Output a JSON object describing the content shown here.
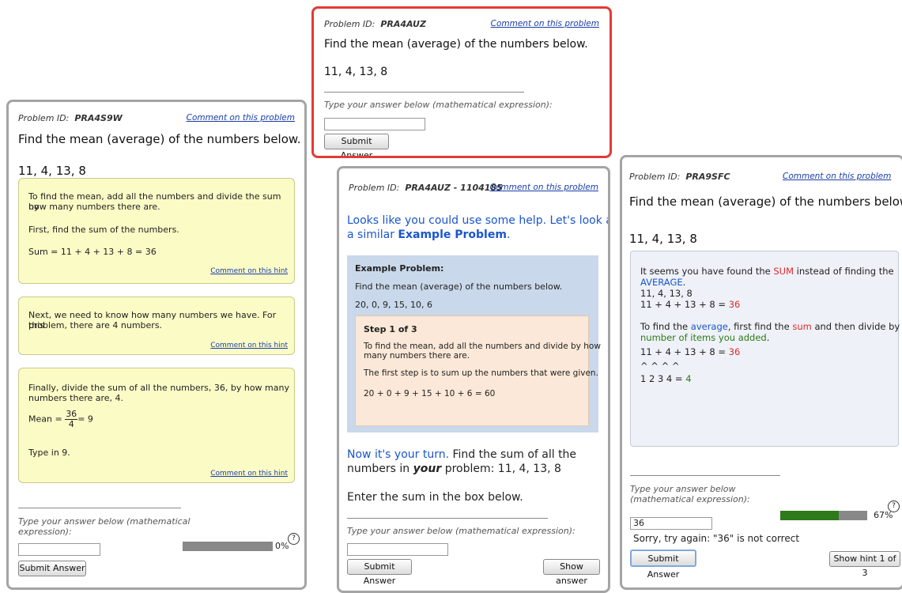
{
  "p1": {
    "problem_id_label": "Problem ID:",
    "problem_id": "PRA4S9W",
    "comment_link": "Comment on this problem",
    "question": "Find the mean (average) of the numbers below.",
    "numbers": "11,  4,  13,  8",
    "hint1": {
      "line1": "To find the mean, add all the numbers and divide the sum by",
      "line2": "how many numbers there are.",
      "line3": "First, find the sum of the numbers.",
      "line4": "Sum = 11 + 4 + 13 + 8 = 36",
      "link": "Comment on this hint"
    },
    "hint2": {
      "line1": "Next, we need to know how many numbers we have.  For this",
      "line2": "problem, there are 4 numbers.",
      "link": "Comment on this hint"
    },
    "hint3": {
      "line1": "Finally, divide the sum of all the numbers, 36, by how many",
      "line2": "numbers there are, 4.",
      "mean_label": "Mean =",
      "frac_num": "36",
      "frac_den": "4",
      "mean_result": "= 9",
      "line4": "Type in 9.",
      "link": "Comment on this hint"
    },
    "prompt_line1": "Type your answer below (mathematical",
    "prompt_line2": "expression):",
    "answer_value": "",
    "submit": "Submit Answer",
    "progress_pct": 0,
    "progress_label": "0%",
    "help_glyph": "?"
  },
  "p2": {
    "problem_id_label": "Problem ID:",
    "problem_id": "PRA4AUZ",
    "comment_link": "Comment on this problem",
    "question": "Find the mean (average) of the numbers below.",
    "numbers": "11,  4,  13,  8",
    "prompt": "Type your answer below (mathematical expression):",
    "answer_value": "",
    "submit": "Submit Answer"
  },
  "p3": {
    "problem_id_label": "Problem ID:",
    "problem_id": "PRA4AUZ - 1104185",
    "comment_link": "Comment on this problem",
    "help_line1": "Looks like you could use some help. Let's look at",
    "help_line2a": "a similar",
    "help_line2b": "Example Problem",
    "help_line2c": ".",
    "example_title": "Example Problem:",
    "example_question": "Find the mean (average) of the numbers below.",
    "example_numbers": "20,  0,  9,  15,  10,  6",
    "step_title": "Step 1 of 3",
    "step_line1": "To find the mean, add all the numbers and divide by how",
    "step_line2": "many numbers there are.",
    "step_line3": "The first step is to sum up the numbers that were given.",
    "step_line4": "20 + 0 + 9 + 15 + 10 + 6  = 60",
    "turn_a": "Now it's your turn.",
    "turn_b": "Find the sum of all the",
    "turn_line2a": "numbers in",
    "turn_line2b": "your",
    "turn_line2c": "problem: 11, 4, 13, 8",
    "enter_sum": "Enter the sum in the box below.",
    "prompt": "Type your answer below (mathematical expression):",
    "answer_value": "",
    "submit": "Submit Answer",
    "show_answer": "Show answer"
  },
  "p4": {
    "problem_id_label": "Problem ID:",
    "problem_id": "PRA9SFC",
    "comment_link": "Comment on this problem",
    "question": "Find the mean (average) of the numbers below.",
    "numbers": "11,  4,  13,  8",
    "fb": {
      "l1a": "It seems you have found the",
      "l1b": "SUM",
      "l1c": "instead of finding the",
      "l2": "AVERAGE",
      "l2b": ".",
      "l3": "11,  4,  13,  8",
      "l4a": "11 + 4 + 13 + 8 =",
      "l4b": "36",
      "l5a": "To find the",
      "l5b": "average",
      "l5c": ", first find the",
      "l5d": "sum",
      "l5e": "and then divide by the",
      "l6a": "number of items you added",
      "l6b": ".",
      "l7a": "11 + 4 + 13 + 8 =",
      "l7b": "36",
      "l8": "^     ^    ^     ^",
      "l9a": "1    2  3    4 =",
      "l9b": "4"
    },
    "prompt_line1": "Type your answer below",
    "prompt_line2": "(mathematical expression):",
    "answer_value": "36",
    "feedback": "Sorry, try again: \"36\" is not correct",
    "submit": "Submit Answer",
    "show_hint": "Show hint 1 of 3",
    "progress_pct": 67,
    "progress_label": "67%",
    "help_glyph": "?"
  },
  "colors": {
    "accent_red": "#e23a36",
    "hint_bg": "#fbfbc6",
    "link": "#1a3ea8",
    "progress": "#2f7a1a",
    "example_bg": "#c9d8ea",
    "step_bg": "#fbe8d8"
  }
}
